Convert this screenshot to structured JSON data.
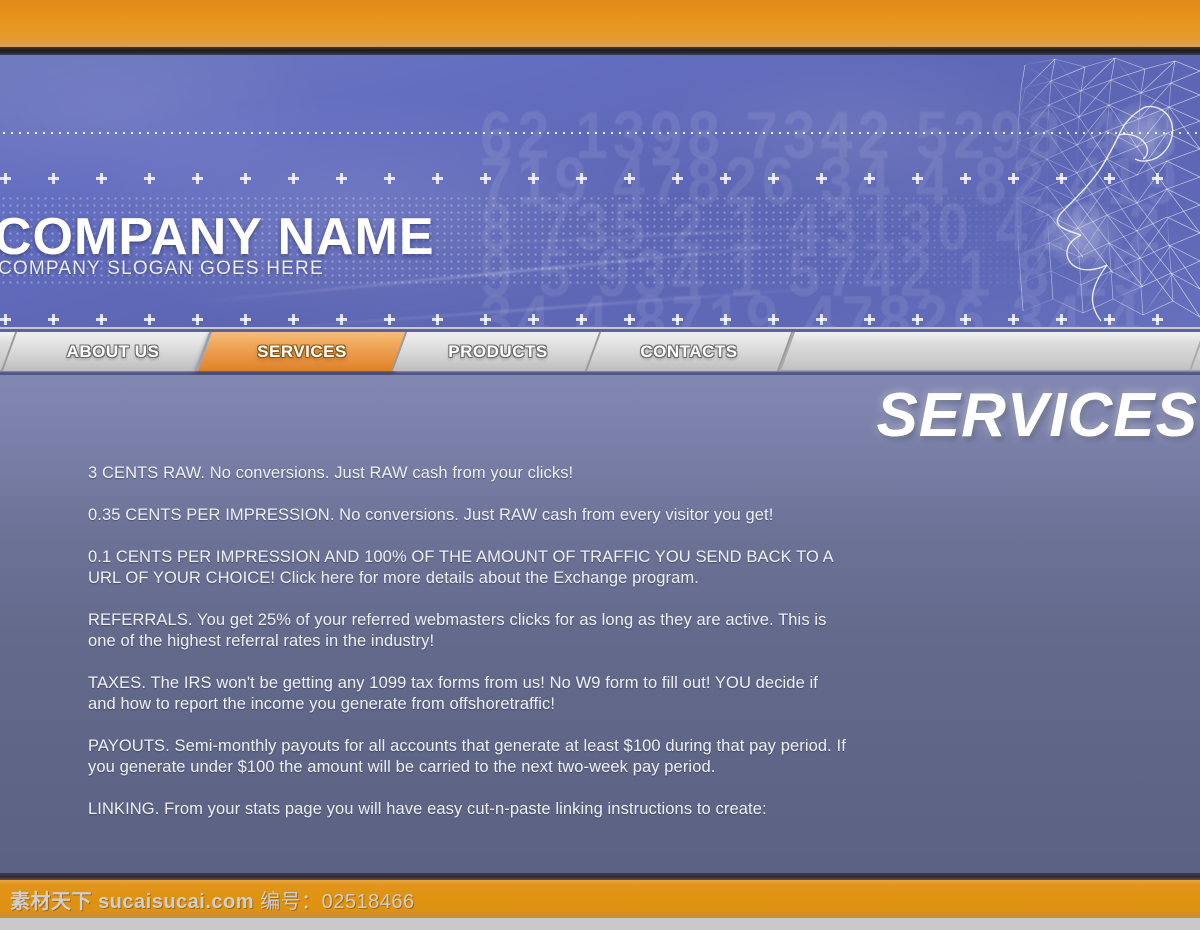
{
  "banner": {
    "company_name": "COMPANY NAME",
    "slogan": "COMPANY SLOGAN GOES HERE",
    "background_digits": "62 1398 7342 5298 4 8719 47826 34 4 82 4198 735 2 1 43130 428 29 5 934 1 5742 1 8 29 34 4 8719 47826 34 4 2 1398 7342 5298 4 1 9 7 3 4 0 2 8 6 5",
    "face_graphic": "wireframe-face"
  },
  "nav": {
    "items": [
      {
        "label": "ABOUT US",
        "active": false
      },
      {
        "label": "SERVICES",
        "active": true
      },
      {
        "label": "PRODUCTS",
        "active": false
      },
      {
        "label": "CONTACTS",
        "active": false
      }
    ]
  },
  "main": {
    "heading": "SERVICES",
    "paragraphs": [
      "3 CENTS RAW. No conversions. Just RAW cash from your clicks!",
      "0.35 CENTS PER IMPRESSION. No conversions. Just RAW cash from every visitor you get!",
      "0.1 CENTS PER IMPRESSION AND 100% OF THE AMOUNT OF TRAFFIC YOU SEND BACK TO A URL OF YOUR CHOICE! Click here for more details about the Exchange program.",
      "REFERRALS. You get 25% of your referred webmasters clicks for as long as they are active. This is one of the highest referral rates in the industry!",
      "TAXES. The IRS won't be getting any 1099 tax forms from us! No W9 form to fill out! YOU decide if and how to report the income you generate from offshoretraffic!",
      "PAYOUTS. Semi-monthly payouts for all accounts that generate at least $100 during that pay period. If you generate under $100 the amount will be carried to the next two-week pay period.",
      "LINKING. From your stats page you will have easy cut-n-paste linking instructions to create:"
    ]
  },
  "footer": {
    "watermark_cn": "素材天下",
    "watermark_site": "sucaisucai.com",
    "watermark_label": "编号：",
    "watermark_id": "02518466"
  },
  "colors": {
    "orange": "#e0930f",
    "banner_blue": "#5d66b4",
    "content_slate": "#636a8c",
    "tab_active": "#e99140",
    "tab_inactive": "#dcdcdc"
  }
}
